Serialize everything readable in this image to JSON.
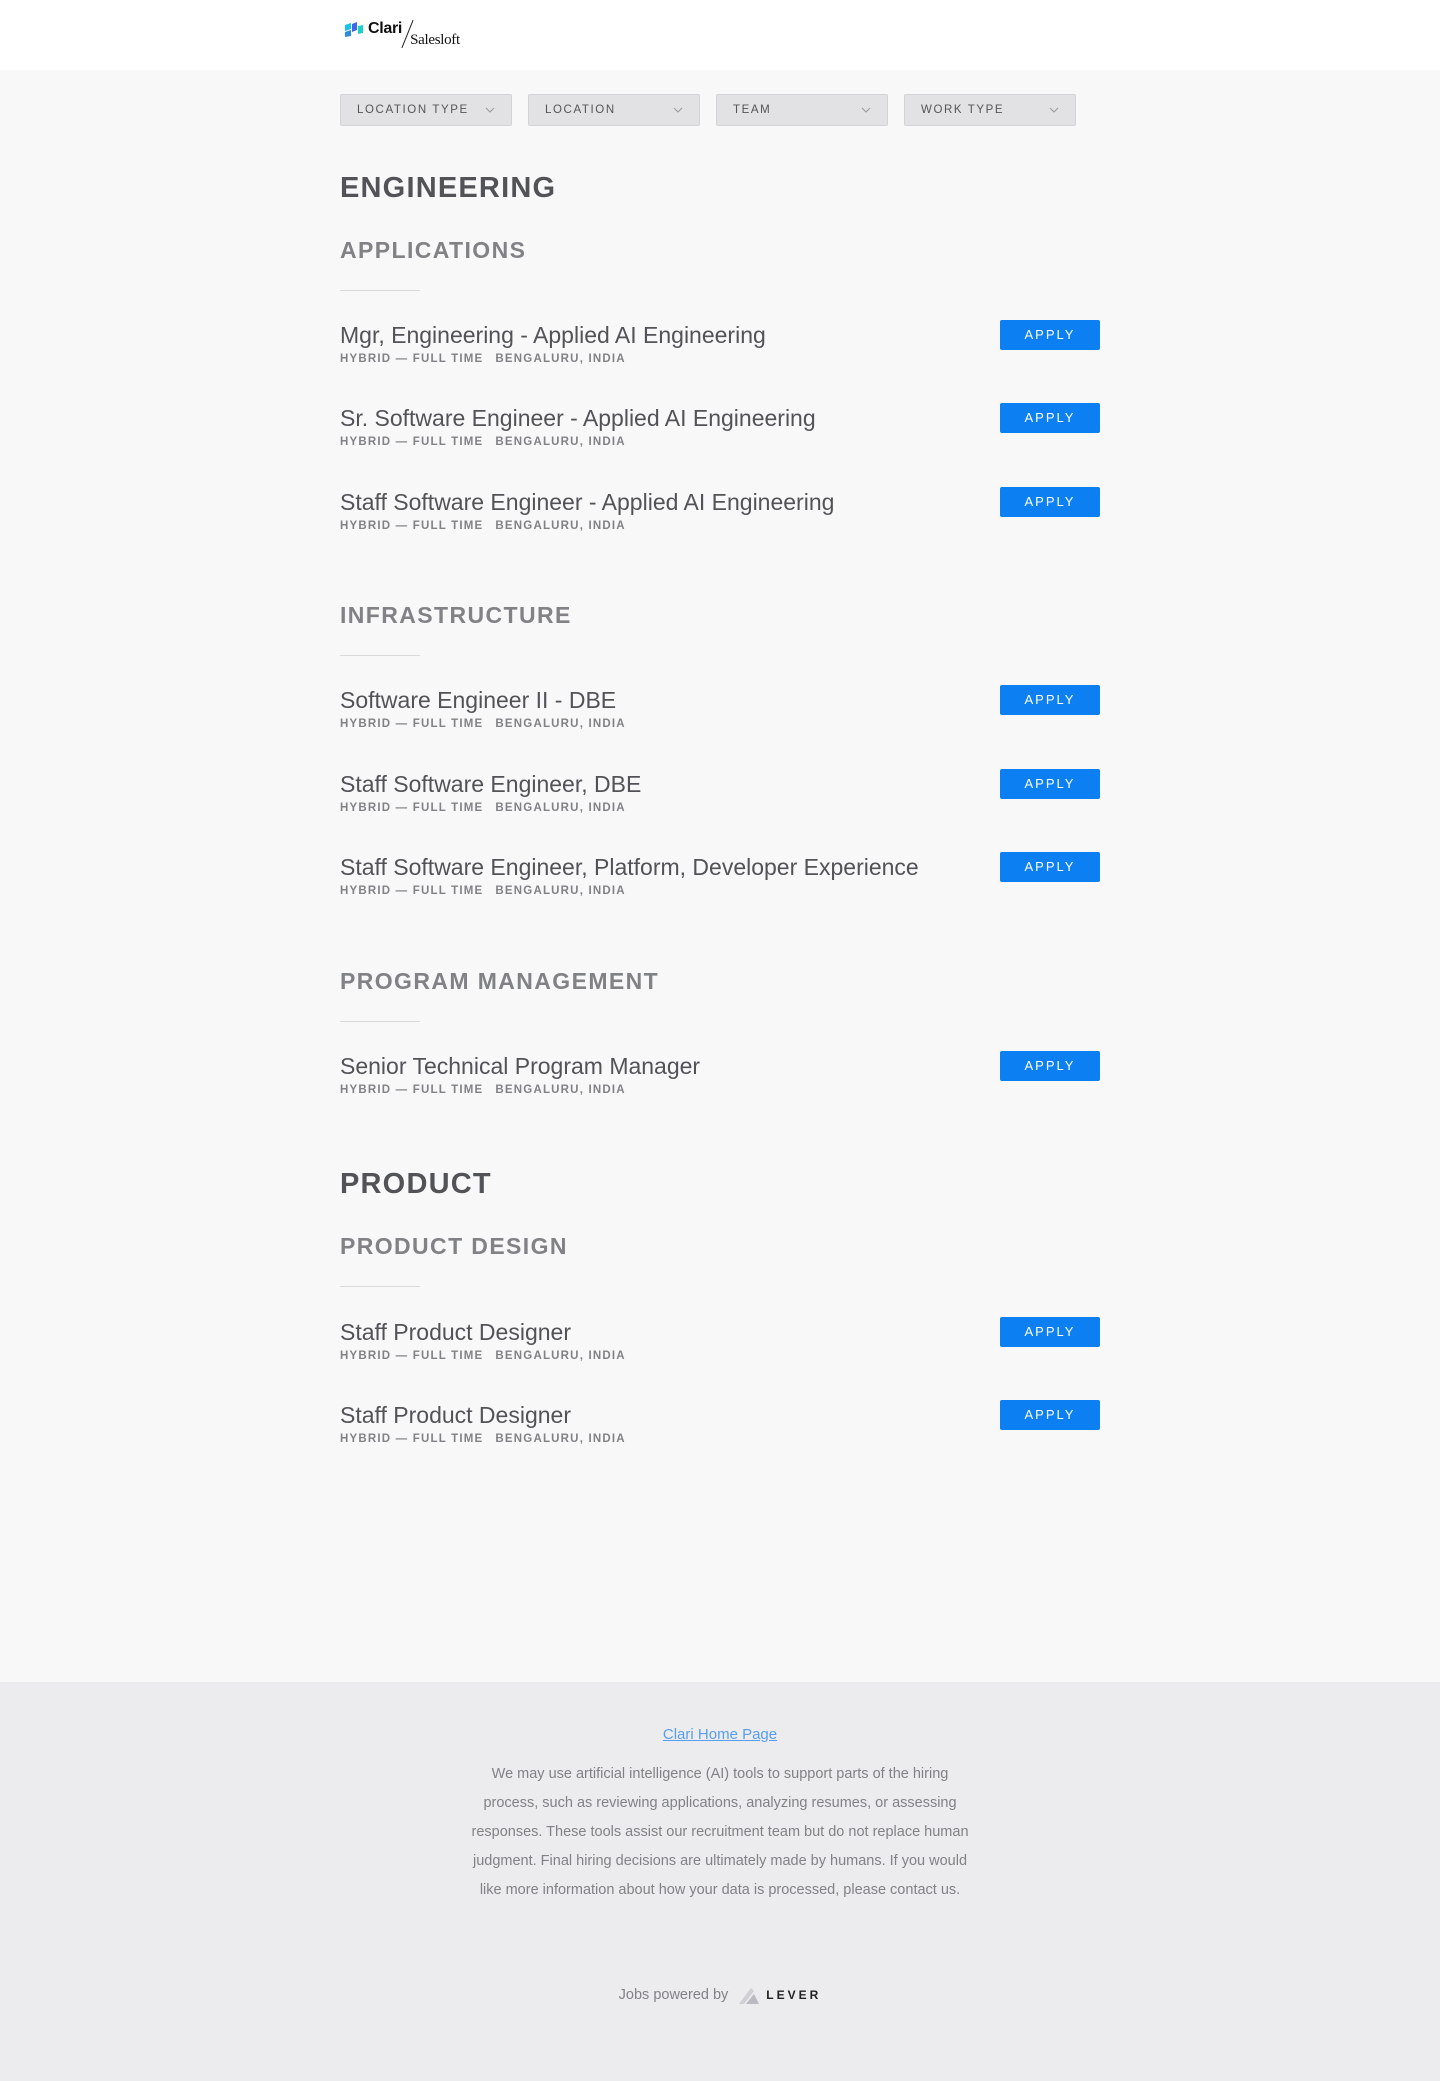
{
  "header": {
    "brand_primary": "Clari",
    "brand_secondary": "Salesloft"
  },
  "filters": [
    {
      "label": "LOCATION TYPE"
    },
    {
      "label": "LOCATION"
    },
    {
      "label": "TEAM"
    },
    {
      "label": "WORK TYPE"
    }
  ],
  "colors": {
    "apply_button": "#0c7ff2",
    "link": "#579eee",
    "footer_bg": "#ececef",
    "page_bg": "#f8f8f9"
  },
  "apply_label": "APPLY",
  "departments": [
    {
      "name": "ENGINEERING",
      "teams": [
        {
          "name": "APPLICATIONS",
          "postings": [
            {
              "title": "Mgr, Engineering - Applied AI Engineering",
              "commitment": "HYBRID — FULL TIME",
              "location": "BENGALURU, INDIA"
            },
            {
              "title": "Sr. Software Engineer - Applied AI Engineering",
              "commitment": "HYBRID — FULL TIME",
              "location": "BENGALURU, INDIA"
            },
            {
              "title": "Staff Software Engineer - Applied AI Engineering",
              "commitment": "HYBRID — FULL TIME",
              "location": "BENGALURU, INDIA"
            }
          ]
        },
        {
          "name": "INFRASTRUCTURE",
          "postings": [
            {
              "title": "Software Engineer II - DBE",
              "commitment": "HYBRID — FULL TIME",
              "location": "BENGALURU, INDIA"
            },
            {
              "title": "Staff Software Engineer, DBE",
              "commitment": "HYBRID — FULL TIME",
              "location": "BENGALURU, INDIA"
            },
            {
              "title": "Staff Software Engineer, Platform, Developer Experience",
              "commitment": "HYBRID — FULL TIME",
              "location": "BENGALURU, INDIA"
            }
          ]
        },
        {
          "name": "PROGRAM MANAGEMENT",
          "postings": [
            {
              "title": "Senior Technical Program Manager",
              "commitment": "HYBRID — FULL TIME",
              "location": "BENGALURU, INDIA"
            }
          ]
        }
      ]
    },
    {
      "name": "PRODUCT",
      "teams": [
        {
          "name": "PRODUCT DESIGN",
          "postings": [
            {
              "title": "Staff Product Designer",
              "commitment": "HYBRID — FULL TIME",
              "location": "BENGALURU, INDIA"
            },
            {
              "title": "Staff Product Designer",
              "commitment": "HYBRID — FULL TIME",
              "location": "BENGALURU, INDIA"
            }
          ]
        }
      ]
    }
  ],
  "footer": {
    "home_link": "Clari Home Page",
    "ai_notice": "We may use artificial intelligence (AI) tools to support parts of the hiring process, such as reviewing applications, analyzing resumes, or assessing responses. These tools assist our recruitment team but do not replace human judgment. Final hiring decisions are ultimately made by humans. If you would like more information about how your data is processed, please contact us.",
    "powered_by": "Jobs powered by",
    "powered_brand": "LEVER"
  }
}
